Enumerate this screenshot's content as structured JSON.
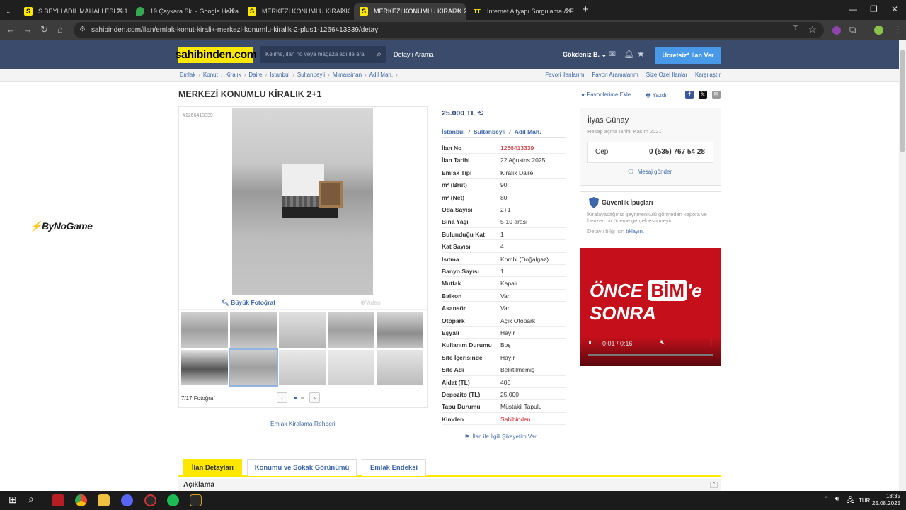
{
  "browser": {
    "tabs": [
      {
        "label": "S.BEYLİ ADİL MAHALLESİ 2+1 K",
        "favicon": "S",
        "fav_color": "#ffe800"
      },
      {
        "label": "19 Çaykara Sk. - Google Harita",
        "favicon": "map-pin",
        "fav_color": "#34a853"
      },
      {
        "label": "MERKEZİ KONUMLU KİRALIK 2",
        "favicon": "S",
        "fav_color": "#ffe800"
      },
      {
        "label": "MERKEZİ KONUMLU KİRALIK 2",
        "favicon": "S",
        "fav_color": "#ffe800"
      },
      {
        "label": "İnternet Altyapı Sorgulama & F",
        "favicon": "TT",
        "fav_color": "#ffe800"
      }
    ],
    "new_tab": "+",
    "url": "sahibinden.com/ilan/emlak-konut-kiralik-merkezi-konumlu-kiralik-2-plus1-1266413339/detay"
  },
  "header": {
    "logo": "sahibinden.com",
    "search_placeholder": "Kelime, ilan no veya mağaza adı ile ara",
    "detail_search": "Detaylı Arama",
    "user": "Gökdeniz B.",
    "free_ad": "Ücretsiz* İlan Ver"
  },
  "breadcrumb": [
    "Emlak",
    "Konut",
    "Kiralık",
    "Daire",
    "İstanbul",
    "Sultanbeyli",
    "Mimarsinan",
    "Adil Mah."
  ],
  "top_links": [
    "Favori İlanlarım",
    "Favori Aramalarım",
    "Size Özel İlanlar",
    "Karşılaştır"
  ],
  "listing": {
    "title": "MERKEZİ KONUMLU KİRALIK 2+1",
    "fav_add": "Favorilerime Ekle",
    "print": "Yazdır",
    "ad_id_label": "#1266413339",
    "big_photo": "Büyük Fotoğraf",
    "video": "Video",
    "photo_count": "7/17 Fotoğraf",
    "rent_guide": "Emlak Kiralama Rehberi",
    "price": "25.000 TL",
    "location": [
      "İstanbul",
      "Sultanbeyli",
      "Adil Mah."
    ],
    "complaint": "İlan ile İlgili Şikayetim Var"
  },
  "details": [
    {
      "k": "İlan No",
      "v": "1266413339",
      "red": true
    },
    {
      "k": "İlan Tarihi",
      "v": "22 Ağustos 2025"
    },
    {
      "k": "Emlak Tipi",
      "v": "Kiralık Daire"
    },
    {
      "k": "m² (Brüt)",
      "v": "90"
    },
    {
      "k": "m² (Net)",
      "v": "80"
    },
    {
      "k": "Oda Sayısı",
      "v": "2+1"
    },
    {
      "k": "Bina Yaşı",
      "v": "5-10 arası"
    },
    {
      "k": "Bulunduğu Kat",
      "v": "1"
    },
    {
      "k": "Kat Sayısı",
      "v": "4"
    },
    {
      "k": "Isıtma",
      "v": "Kombi (Doğalgaz)"
    },
    {
      "k": "Banyo Sayısı",
      "v": "1"
    },
    {
      "k": "Mutfak",
      "v": "Kapalı"
    },
    {
      "k": "Balkon",
      "v": "Var"
    },
    {
      "k": "Asansör",
      "v": "Var"
    },
    {
      "k": "Otopark",
      "v": "Açık Otopark"
    },
    {
      "k": "Eşyalı",
      "v": "Hayır"
    },
    {
      "k": "Kullanım Durumu",
      "v": "Boş"
    },
    {
      "k": "Site İçerisinde",
      "v": "Hayır"
    },
    {
      "k": "Site Adı",
      "v": "Belirtilmemiş"
    },
    {
      "k": "Aidat (TL)",
      "v": "400"
    },
    {
      "k": "Depozito (TL)",
      "v": "25.000"
    },
    {
      "k": "Tapu Durumu",
      "v": "Müstakil Tapulu"
    },
    {
      "k": "Kimden",
      "v": "Sahibinden",
      "red": true
    }
  ],
  "seller": {
    "name": "İlyas Günay",
    "since": "Hesap açma tarihi: Kasım 2021",
    "phone_label": "Cep",
    "phone": "0 (535) 767 54 28",
    "message": "Mesaj gönder"
  },
  "security": {
    "title": "Güvenlik İpuçları",
    "text": "Kiralayacağınız gayrimenkulü görmeden kapora ve benzeri bir ödeme gerçekleştirmeyin.",
    "more_prefix": "Detaylı bilgi için",
    "more_link": "tıklayın."
  },
  "ad": {
    "line1": "ÖNCE",
    "bim": "BİM",
    "suffix": "'e",
    "line2": "SONRA",
    "time": "0:01 / 0:16"
  },
  "watermark": "ByNoGame",
  "bottom_tabs": [
    "İlan Detayları",
    "Konumu ve Sokak Görünümü",
    "Emlak Endeksi"
  ],
  "description_title": "Açıklama",
  "taskbar": {
    "lang": "TUR",
    "time": "18:35",
    "date": "25.08.2025"
  }
}
